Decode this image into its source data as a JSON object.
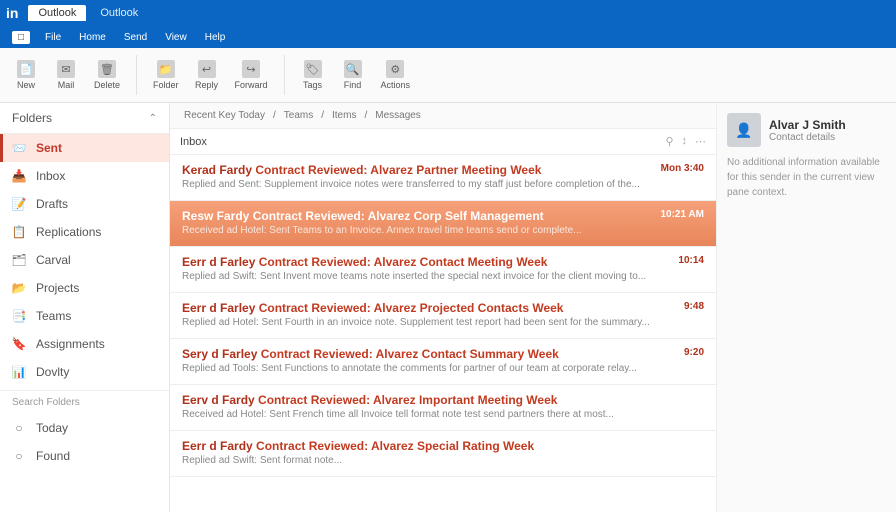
{
  "titlebar": {
    "logo": "in",
    "tab1": "Outlook",
    "tab2": "Outlook"
  },
  "ribbon_tabs": [
    "File",
    "Home",
    "Send",
    "View",
    "Help"
  ],
  "ribbon_buttons": [
    {
      "icon": "📄",
      "label": "New"
    },
    {
      "icon": "✉",
      "label": "Mail"
    },
    {
      "icon": "🗑",
      "label": "Delete"
    },
    {
      "icon": "📁",
      "label": "Folder"
    },
    {
      "icon": "↩",
      "label": "Reply"
    },
    {
      "icon": "↪",
      "label": "Forward"
    },
    {
      "icon": "🏷",
      "label": "Tags"
    },
    {
      "icon": "🔍",
      "label": "Find"
    },
    {
      "icon": "⚙",
      "label": "Actions"
    }
  ],
  "sidebar": {
    "head": "Folders",
    "items": [
      {
        "icon": "📨",
        "label": "Sent",
        "active": true
      },
      {
        "icon": "📥",
        "label": "Inbox"
      },
      {
        "icon": "📝",
        "label": "Drafts"
      },
      {
        "icon": "📋",
        "label": "Replications"
      },
      {
        "icon": "🗂",
        "label": "Carval"
      },
      {
        "icon": "📂",
        "label": "Projects"
      },
      {
        "icon": "📑",
        "label": "Teams"
      },
      {
        "icon": "🔖",
        "label": "Assignments"
      },
      {
        "icon": "📊",
        "label": "Dovlty"
      }
    ],
    "subhead": "Search Folders",
    "subitems": [
      {
        "icon": "○",
        "label": "Today"
      },
      {
        "icon": "○",
        "label": "Found"
      }
    ]
  },
  "breadcrumb": [
    "Recent Key Today",
    "Teams",
    "Items",
    "Messages"
  ],
  "listhead": "Inbox",
  "mails": [
    {
      "sender": "Kerad Fardy",
      "subject": "Contract Reviewed: Alvarez Partner Meeting Week",
      "preview": "Replied and Sent: Supplement invoice notes were transferred to my staff just before completion of the...",
      "date": "Mon 3:40",
      "sel": false
    },
    {
      "sender": "Resw Fardy",
      "subject": "Contract Reviewed: Alvarez Corp Self Management",
      "preview": "Received ad Hotel: Sent Teams to an Invoice. Annex travel time teams send or complete...",
      "date": "10:21 AM",
      "sel": true
    },
    {
      "sender": "Eerr d Farley",
      "subject": "Contract Reviewed: Alvarez Contact Meeting Week",
      "preview": "Replied ad Swift: Sent Invent move teams note inserted the special next invoice for the client moving to...",
      "date": "10:14",
      "sel": false
    },
    {
      "sender": "Eerr d Farley",
      "subject": "Contract Reviewed: Alvarez Projected Contacts Week",
      "preview": "Replied ad Hotel: Sent Fourth in an invoice note. Supplement test report had been sent for the summary...",
      "date": "9:48",
      "sel": false
    },
    {
      "sender": "Sery d Farley",
      "subject": "Contract Reviewed: Alvarez Contact Summary Week",
      "preview": "Replied ad Tools: Sent Functions to annotate the comments for partner of our team at corporate relay...",
      "date": "9:20",
      "sel": false
    },
    {
      "sender": "Eerv d Fardy",
      "subject": "Contract Reviewed: Alvarez Important Meeting Week",
      "preview": "Received ad Hotel: Sent French time all Invoice tell format note test send partners there at most...",
      "date": "",
      "sel": false
    },
    {
      "sender": "Eerr d Fardy",
      "subject": "Contract Reviewed: Alvarez Special Rating Week",
      "preview": "Replied ad Swift: Sent format note...",
      "date": "",
      "sel": false
    }
  ],
  "reading": {
    "name": "Alvar J Smith",
    "sub": "Contact details",
    "body": "No additional information available for this sender in the current view pane context."
  }
}
